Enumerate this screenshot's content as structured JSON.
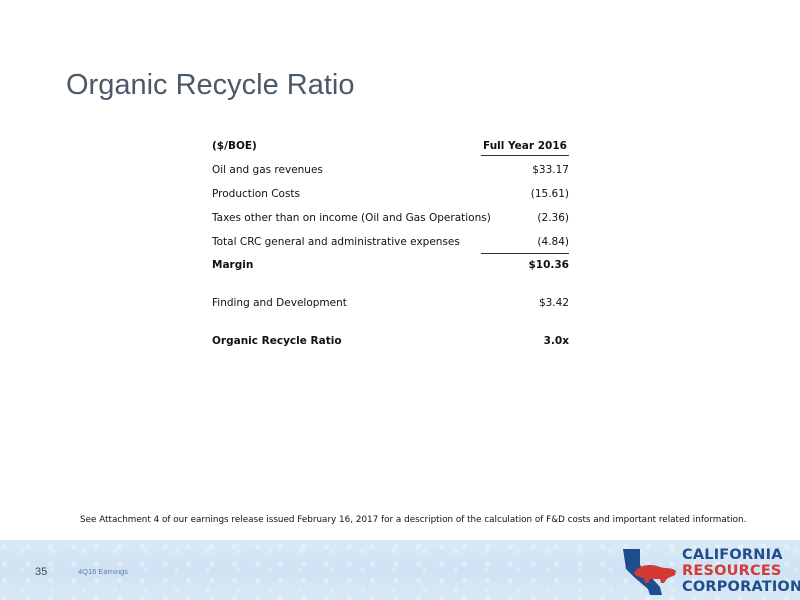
{
  "slide": {
    "title": "Organic Recycle Ratio",
    "page_number": "35",
    "footer_label": "4Q16 Earnings"
  },
  "table": {
    "header": {
      "label": "($/BOE)",
      "column": "Full Year 2016"
    },
    "rows": [
      {
        "label": "Oil and gas revenues",
        "value": "$33.17"
      },
      {
        "label": "Production Costs",
        "value": "(15.61)"
      },
      {
        "label": "Taxes other than on income (Oil and Gas Operations)",
        "value": "(2.36)"
      },
      {
        "label": "Total CRC general and administrative expenses",
        "value": "(4.84)"
      },
      {
        "label": "Margin",
        "value": "$10.36"
      },
      {
        "label": "Finding and Development",
        "value": "$3.42"
      },
      {
        "label": "Organic Recycle Ratio",
        "value": "3.0x"
      }
    ]
  },
  "footnote": "See Attachment 4 of our earnings release issued February 16, 2017 for a description of the calculation of F&D costs and important related information.",
  "logo": {
    "line1": "CALIFORNIA",
    "line2": "RESOURCES",
    "line3": "CORPORATION",
    "colors": {
      "blue": "#1f4e8c",
      "red": "#d33a35"
    }
  }
}
